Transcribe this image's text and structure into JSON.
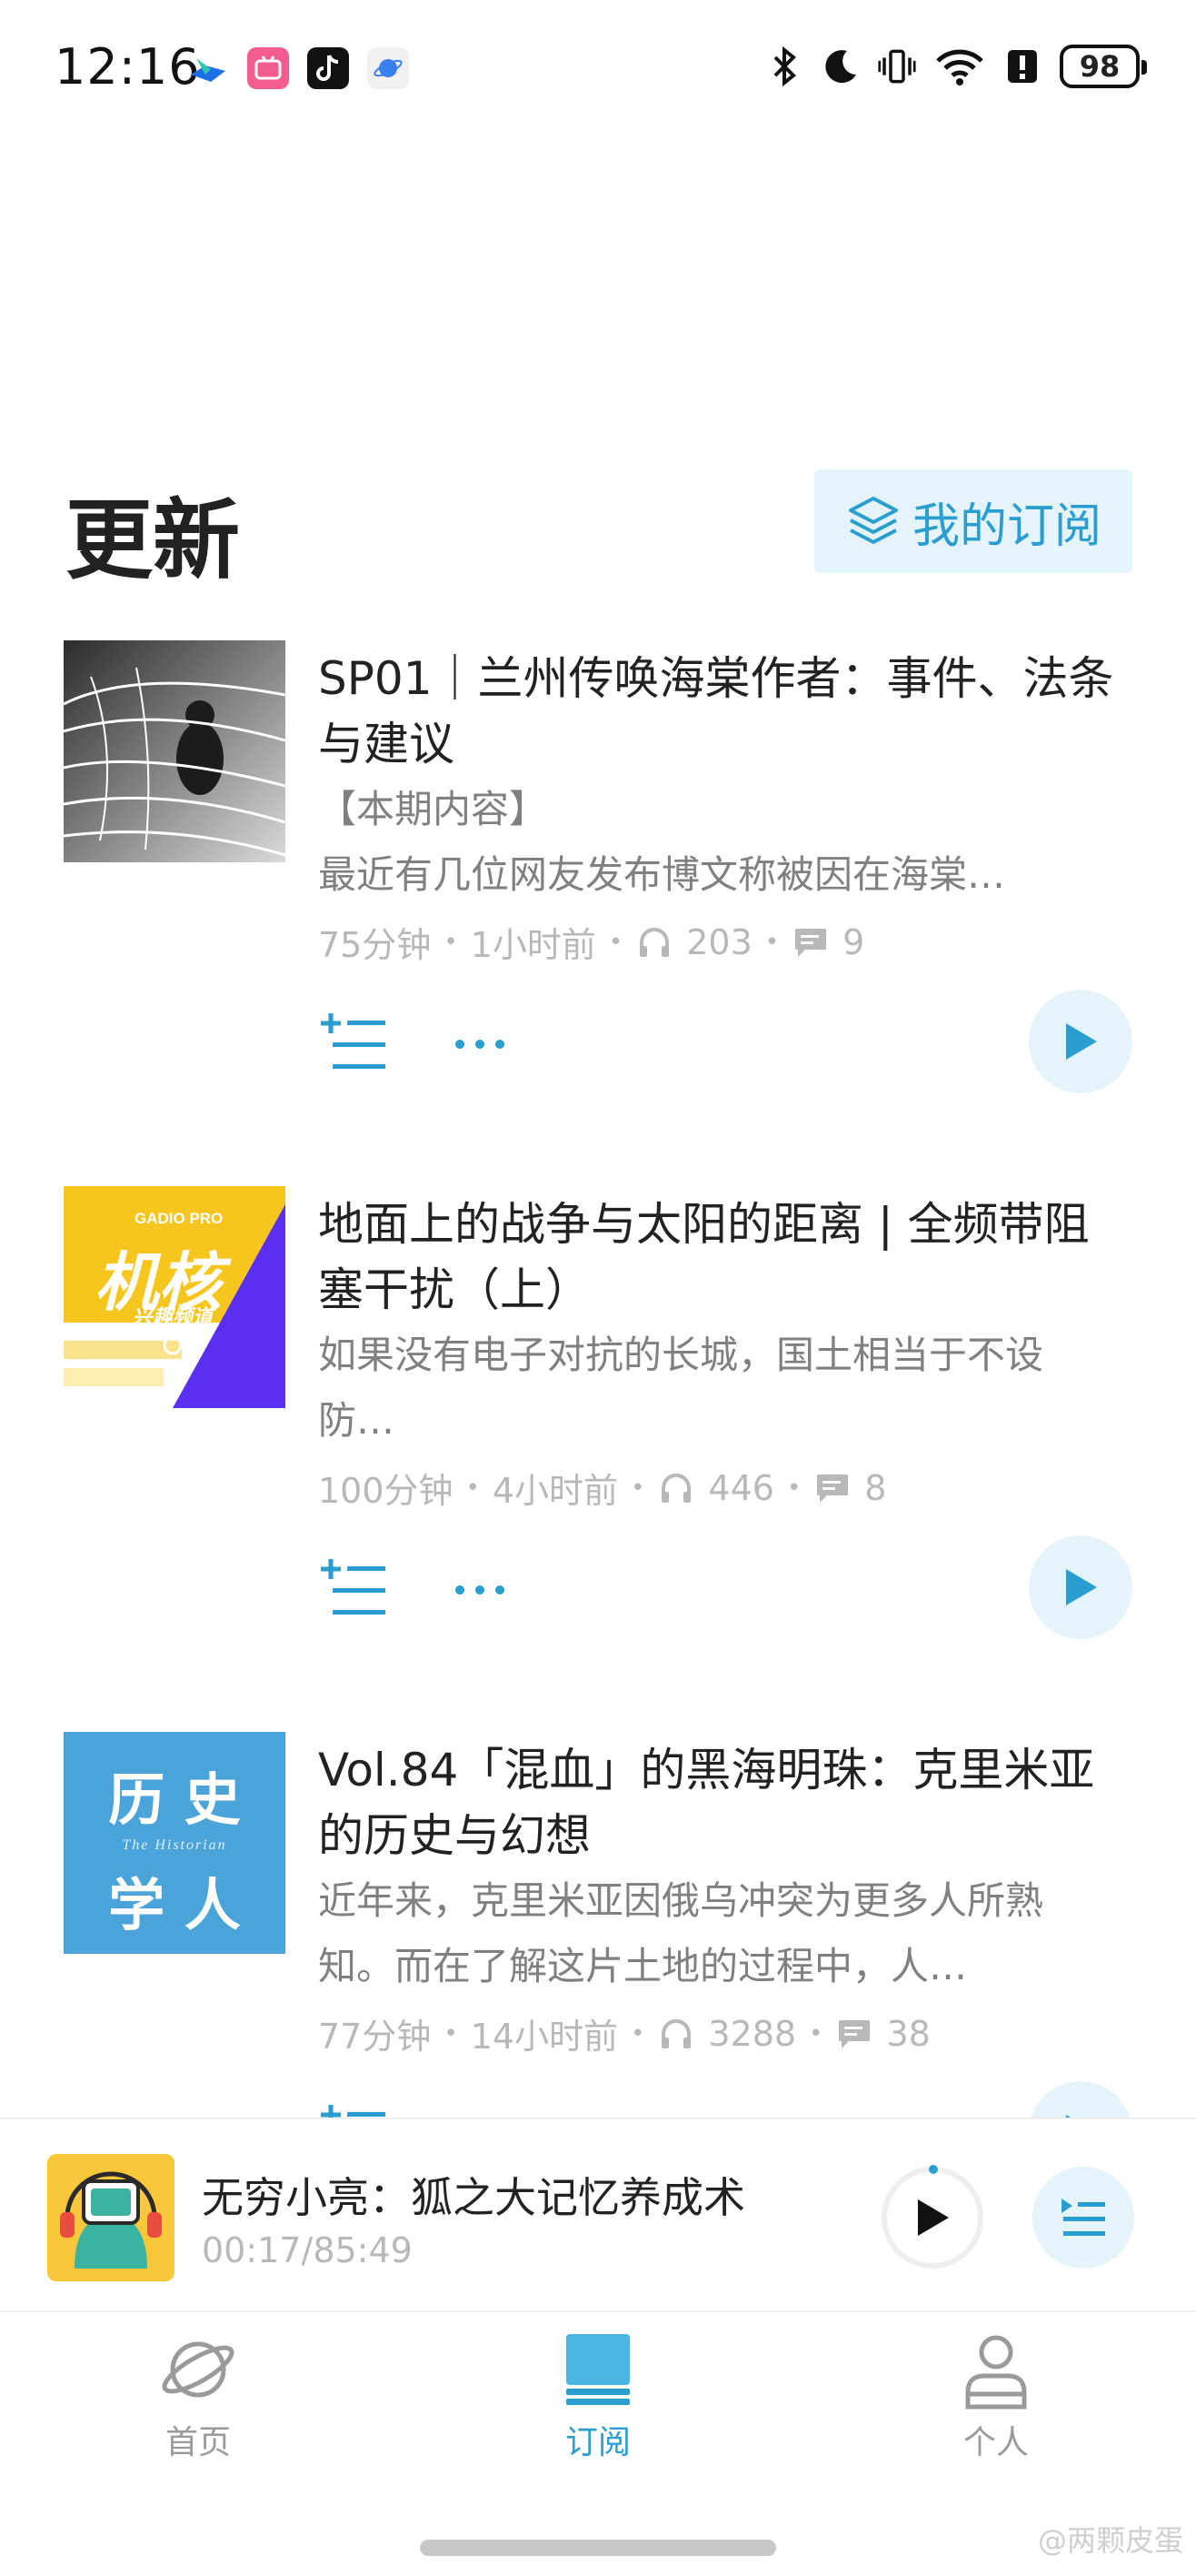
{
  "status_bar": {
    "time": "12:16",
    "notification_icons": [
      "lark-icon",
      "bilibili-icon",
      "tiktok-icon",
      "browser-icon"
    ],
    "system_icons": [
      "bluetooth-icon",
      "moon-icon",
      "vibrate-icon",
      "wifi-icon",
      "alert-icon"
    ],
    "battery": "98"
  },
  "header": {
    "title": "更新",
    "subscriptions_button": "我的订阅"
  },
  "episodes": [
    {
      "title": "SP01｜兰州传唤海棠作者：事件、法条与建议",
      "description": "【本期内容】\n最近有几位网友发布博文称被因在海棠…",
      "duration": "75分钟",
      "published": "1小时前",
      "plays": "203",
      "comments": "9"
    },
    {
      "title": "地面上的战争与太阳的距离 | 全频带阻塞干扰（上）",
      "description": "如果没有电子对抗的长城，国土相当于不设防…",
      "duration": "100分钟",
      "published": "4小时前",
      "plays": "446",
      "comments": "8",
      "cover_text": {
        "brand": "GADIO PRO",
        "name": "机核",
        "channel": "兴趣频道"
      }
    },
    {
      "title": "Vol.84「混血」的黑海明珠：克里米亚的历史与幻想",
      "description": "近年来，克里米亚因俄乌冲突为更多人所熟知。而在了解这片土地的过程中，人…",
      "duration": "77分钟",
      "published": "14小时前",
      "plays": "3288",
      "comments": "38",
      "cover_text": {
        "top": "历 史",
        "sub": "The Historian",
        "bottom": "学 人"
      }
    }
  ],
  "mini_player": {
    "title": "无穷小亮：狐之大记忆养成术",
    "time": "00:17/85:49"
  },
  "tabs": [
    {
      "label": "首页",
      "icon": "planet-icon"
    },
    {
      "label": "订阅",
      "icon": "subscription-icon",
      "active": true
    },
    {
      "label": "个人",
      "icon": "person-icon"
    }
  ],
  "watermark": "@两颗皮蛋",
  "colors": {
    "accent": "#2b9ed0",
    "accent_bg": "#e5f4fa",
    "meta_gray": "#b8b8b8"
  }
}
